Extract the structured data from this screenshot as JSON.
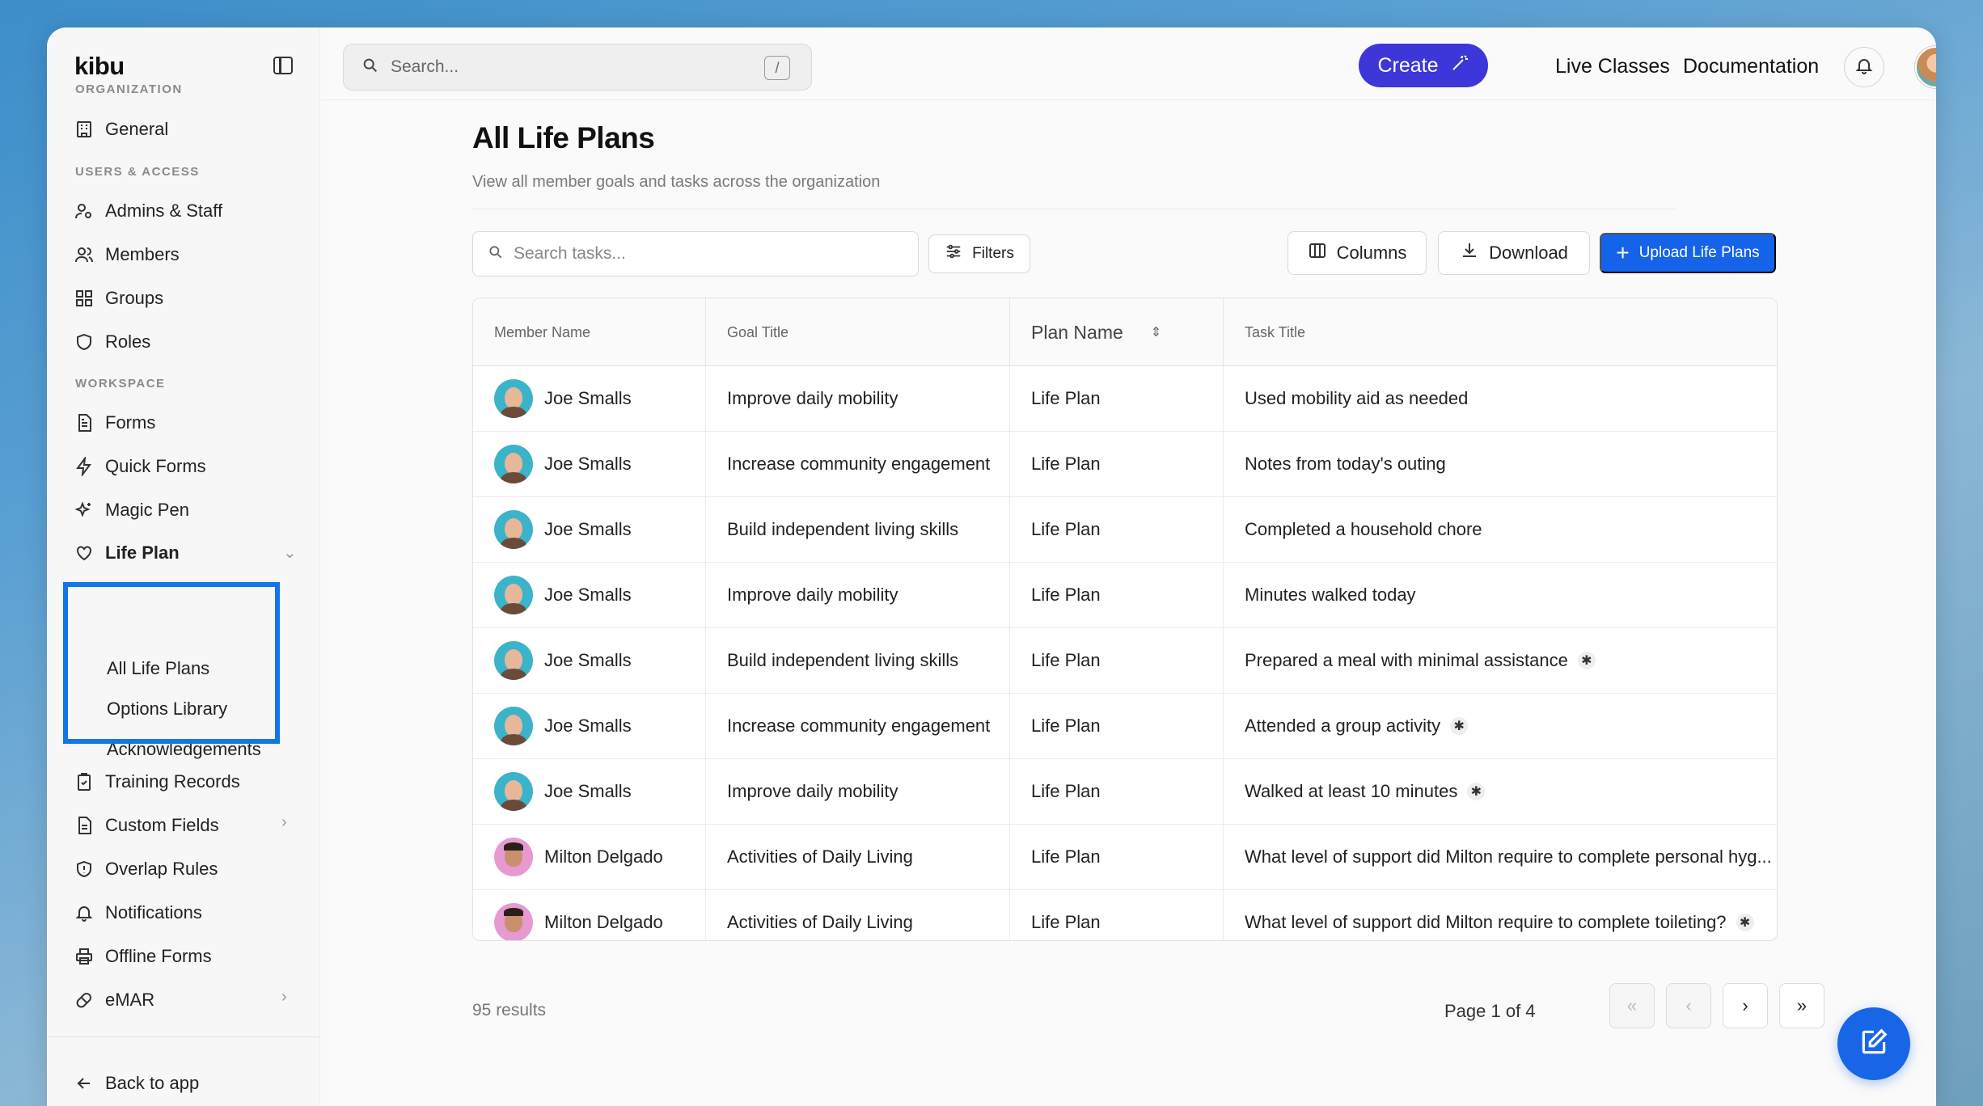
{
  "app": {
    "logo": "kibu"
  },
  "sidebar": {
    "sections": {
      "organization": "ORGANIZATION",
      "users_access": "USERS & ACCESS",
      "workspace": "WORKSPACE"
    },
    "items": {
      "general": "General",
      "admins_staff": "Admins & Staff",
      "members": "Members",
      "groups": "Groups",
      "roles": "Roles",
      "forms": "Forms",
      "quick_forms": "Quick Forms",
      "magic_pen": "Magic Pen",
      "life_plan": "Life Plan",
      "training_records": "Training Records",
      "custom_fields": "Custom Fields",
      "overlap_rules": "Overlap Rules",
      "notifications": "Notifications",
      "offline_forms": "Offline Forms",
      "emar": "eMAR"
    },
    "life_plan_sub": {
      "all_life_plans": "All Life Plans",
      "options_library": "Options Library",
      "acknowledgements": "Acknowledgements"
    },
    "back_to_app": "Back to app"
  },
  "topbar": {
    "search_placeholder": "Search...",
    "search_shortcut": "/",
    "create_label": "Create",
    "live_classes": "Live Classes",
    "documentation": "Documentation"
  },
  "page": {
    "title": "All Life Plans",
    "subtitle": "View all member goals and tasks across the organization",
    "task_search_placeholder": "Search tasks...",
    "filters_label": "Filters",
    "columns_label": "Columns",
    "download_label": "Download",
    "upload_label": "Upload Life Plans"
  },
  "table": {
    "headers": {
      "member_name": "Member Name",
      "goal_title": "Goal Title",
      "plan_name": "Plan Name",
      "task_title": "Task Title"
    },
    "rows": [
      {
        "member": "Joe Smalls",
        "goal": "Improve daily mobility",
        "plan": "Life Plan",
        "task": "Used mobility aid as needed",
        "starred": false
      },
      {
        "member": "Joe Smalls",
        "goal": "Increase community engagement",
        "plan": "Life Plan",
        "task": "Notes from today's outing",
        "starred": false
      },
      {
        "member": "Joe Smalls",
        "goal": "Build independent living skills",
        "plan": "Life Plan",
        "task": "Completed a household chore",
        "starred": false
      },
      {
        "member": "Joe Smalls",
        "goal": "Improve daily mobility",
        "plan": "Life Plan",
        "task": "Minutes walked today",
        "starred": false
      },
      {
        "member": "Joe Smalls",
        "goal": "Build independent living skills",
        "plan": "Life Plan",
        "task": "Prepared a meal with minimal assistance",
        "starred": true
      },
      {
        "member": "Joe Smalls",
        "goal": "Increase community engagement",
        "plan": "Life Plan",
        "task": "Attended a group activity",
        "starred": true
      },
      {
        "member": "Joe Smalls",
        "goal": "Improve daily mobility",
        "plan": "Life Plan",
        "task": "Walked at least 10 minutes",
        "starred": true
      },
      {
        "member": "Milton Delgado",
        "goal": "Activities of Daily Living",
        "plan": "Life Plan",
        "task": "What level of support did Milton require to complete personal hyg...",
        "starred": false
      },
      {
        "member": "Milton Delgado",
        "goal": "Activities of Daily Living",
        "plan": "Life Plan",
        "task": "What level of support did Milton require to complete toileting?",
        "starred": true
      }
    ]
  },
  "footer": {
    "results": "95 results",
    "page_label": "Page 1 of 4",
    "first": "«",
    "prev": "‹",
    "next": "›",
    "last": "»"
  },
  "colors": {
    "accent": "#1563e8",
    "create": "#3d36d8",
    "highlight": "#1376e8"
  }
}
